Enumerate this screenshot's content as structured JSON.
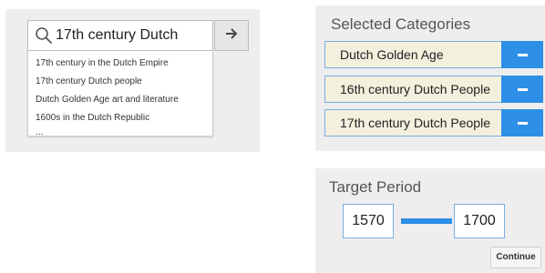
{
  "search": {
    "query": "17th century Dutch",
    "suggestions": [
      "17th century in the Dutch Empire",
      "17th century Dutch people",
      "Dutch Golden Age art and literature",
      "1600s in the Dutch Republic",
      "..."
    ]
  },
  "categories": {
    "title": "Selected Categories",
    "items": [
      "Dutch Golden Age",
      "16th century Dutch People",
      "17th century Dutch People"
    ]
  },
  "period": {
    "title": "Target Period",
    "start": "1570",
    "end": "1700",
    "continue_label": "Continue"
  },
  "colors": {
    "accent": "#2d8fe6",
    "category_bg": "#f3f0dd",
    "panel_bg": "#eeeeee"
  }
}
